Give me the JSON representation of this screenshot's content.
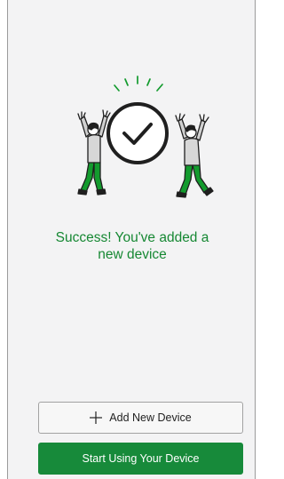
{
  "success": {
    "message_line1": "Success! You've added a",
    "message_line2": "new device"
  },
  "actions": {
    "add_new_device_label": "Add New Device",
    "start_using_label": "Start Using Your Device"
  },
  "colors": {
    "accent_green": "#178a3a",
    "success_text": "#168833",
    "screen_background": "#f3f3f4"
  },
  "icons": {
    "add": "plus-icon",
    "illustration": "celebration-checkmark-illustration"
  }
}
